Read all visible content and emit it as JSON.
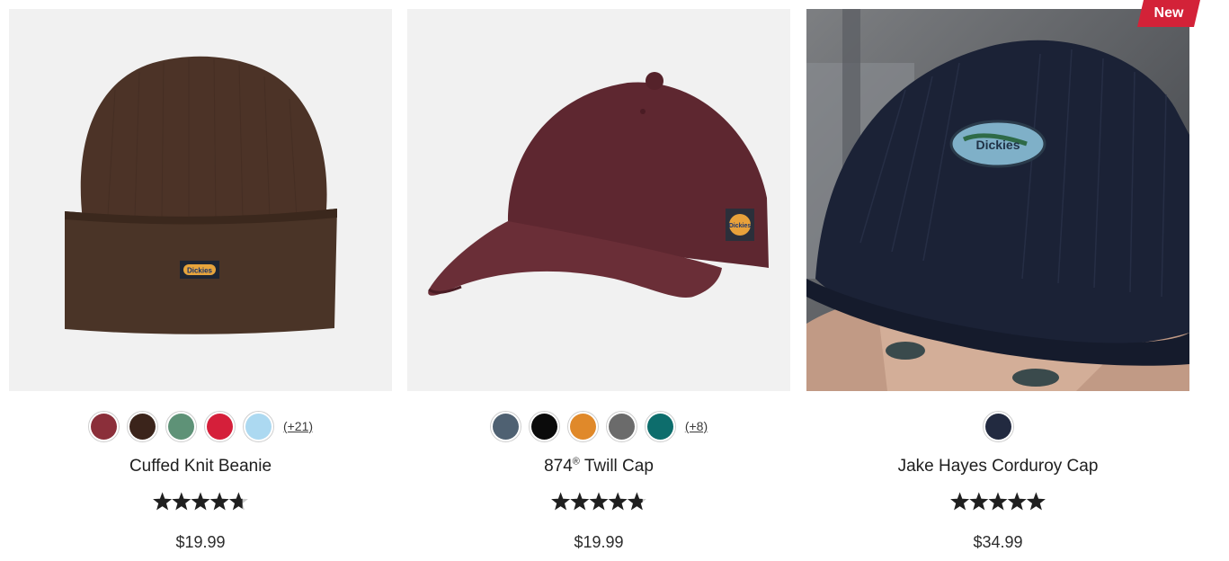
{
  "products": [
    {
      "name": "Cuffed Knit Beanie",
      "price": "$19.99",
      "rating": 4.7,
      "more_colors": "(+21)",
      "swatches": [
        "#8b2f3a",
        "#3b241b",
        "#5e9277",
        "#d51f3a",
        "#acd9f1"
      ],
      "image_alt": "brown cuffed knit beanie"
    },
    {
      "name": "874",
      "name_sup": "®",
      "name_suffix": " Twill Cap",
      "price": "$19.99",
      "rating": 4.8,
      "more_colors": "(+8)",
      "swatches": [
        "#4f6172",
        "#0b0b0b",
        "#e0892a",
        "#6b6b6b",
        "#0d6d6c"
      ],
      "image_alt": "maroon twill baseball cap"
    },
    {
      "name": "Jake Hayes Corduroy Cap",
      "price": "$34.99",
      "rating": 5,
      "badge": "New",
      "swatches": [
        "#222a40"
      ],
      "image_alt": "navy corduroy cap worn by person"
    }
  ],
  "logo_text": "Dickies",
  "icons": {
    "rating": "star-icon"
  }
}
